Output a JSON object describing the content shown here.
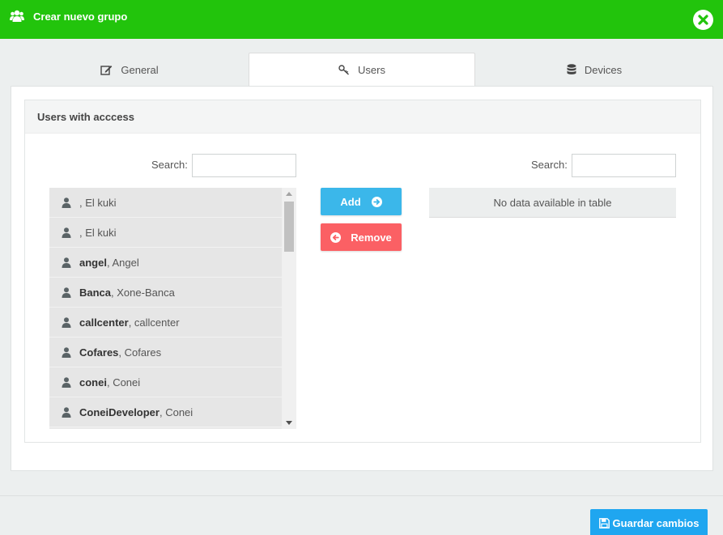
{
  "header": {
    "title": "Crear nuevo grupo",
    "icon": "users-group-icon",
    "close_icon": "close-circle-icon"
  },
  "tabs": [
    {
      "label": "General",
      "icon": "edit-icon",
      "active": false
    },
    {
      "label": "Users",
      "icon": "key-icon",
      "active": true
    },
    {
      "label": "Devices",
      "icon": "database-icon",
      "active": false
    }
  ],
  "panel": {
    "title": "Users with acccess",
    "left_search_label": "Search:",
    "left_search_value": "",
    "right_search_label": "Search:",
    "right_search_value": ""
  },
  "available_users": [
    {
      "login": "",
      "name": ", El kuki"
    },
    {
      "login": "",
      "name": ", El kuki"
    },
    {
      "login": "angel",
      "name": ", Angel"
    },
    {
      "login": "Banca",
      "name": ", Xone-Banca"
    },
    {
      "login": "callcenter",
      "name": ", callcenter"
    },
    {
      "login": "Cofares",
      "name": ", Cofares"
    },
    {
      "login": "conei",
      "name": ", Conei"
    },
    {
      "login": "ConeiDeveloper",
      "name": ", Conei"
    }
  ],
  "buttons": {
    "add_label": "Add",
    "remove_label": "Remove"
  },
  "assigned_table": {
    "empty_text": "No data available in table"
  },
  "footer": {
    "save_label": "Guardar cambios"
  },
  "colors": {
    "header": "#22c40c",
    "add": "#3bb7ea",
    "remove": "#fb6064",
    "save": "#1fa6f0"
  }
}
